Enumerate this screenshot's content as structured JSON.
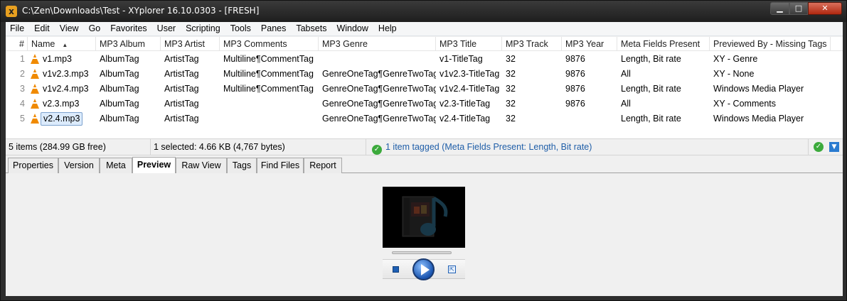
{
  "window": {
    "title": "C:\\Zen\\Downloads\\Test - XYplorer 16.10.0303 - [FRESH]",
    "app_icon": "xyplorer-icon",
    "controls": {
      "minimize": "▁",
      "maximize": "□",
      "close": "✕"
    }
  },
  "menu": [
    "File",
    "Edit",
    "View",
    "Go",
    "Favorites",
    "User",
    "Scripting",
    "Tools",
    "Panes",
    "Tabsets",
    "Window",
    "Help"
  ],
  "list": {
    "columns": {
      "num": "#",
      "name": "Name",
      "album": "MP3 Album",
      "artist": "MP3 Artist",
      "comments": "MP3 Comments",
      "genre": "MP3 Genre",
      "title": "MP3 Title",
      "track": "MP3 Track",
      "year": "MP3 Year",
      "meta": "Meta Fields Present",
      "previewed": "Previewed By - Missing Tags"
    },
    "sort_indicator": "▲",
    "rows": [
      {
        "num": "1",
        "name": "v1.mp3",
        "album": "AlbumTag",
        "artist": "ArtistTag",
        "comments": "Multiline¶CommentTag",
        "genre": "",
        "title": "v1-TitleTag",
        "track": "32",
        "year": "9876",
        "meta": "Length, Bit rate",
        "previewed": "XY - Genre"
      },
      {
        "num": "2",
        "name": "v1v2.3.mp3",
        "album": "AlbumTag",
        "artist": "ArtistTag",
        "comments": "Multiline¶CommentTag",
        "genre": "GenreOneTag¶GenreTwoTag",
        "title": "v1v2.3-TitleTag",
        "track": "32",
        "year": "9876",
        "meta": "All",
        "previewed": "XY - None"
      },
      {
        "num": "3",
        "name": "v1v2.4.mp3",
        "album": "AlbumTag",
        "artist": "ArtistTag",
        "comments": "Multiline¶CommentTag",
        "genre": "GenreOneTag¶GenreTwoTag",
        "title": "v1v2.4-TitleTag",
        "track": "32",
        "year": "9876",
        "meta": "Length, Bit rate",
        "previewed": "Windows Media Player"
      },
      {
        "num": "4",
        "name": "v2.3.mp3",
        "album": "AlbumTag",
        "artist": "ArtistTag",
        "comments": "",
        "genre": "GenreOneTag¶GenreTwoTag",
        "title": "v2.3-TitleTag",
        "track": "32",
        "year": "9876",
        "meta": "All",
        "previewed": "XY - Comments"
      },
      {
        "num": "5",
        "name": "v2.4.mp3",
        "album": "AlbumTag",
        "artist": "ArtistTag",
        "comments": "",
        "genre": "GenreOneTag¶GenreTwoTag",
        "title": "v2.4-TitleTag",
        "track": "32",
        "year": "",
        "meta": "Length, Bit rate",
        "previewed": "Windows Media Player"
      }
    ],
    "selected_index": 4
  },
  "status": {
    "items": "5 items (284.99 GB free)",
    "selected": "1 selected: 4.66 KB (4,767 bytes)",
    "tagged": "1 item tagged (Meta Fields Present: Length, Bit rate)",
    "check_glyph": "✓",
    "dropdown_glyph": "▼"
  },
  "tabs": [
    "Properties",
    "Version",
    "Meta",
    "Preview",
    "Raw View",
    "Tags",
    "Find Files",
    "Report"
  ],
  "active_tab": "Preview",
  "player": {
    "expand_glyph": "⇱"
  },
  "colors": {
    "accent": "#1f5ea8",
    "check": "#3caa3c",
    "vlc": "#f08a00",
    "close": "#c0391b"
  }
}
